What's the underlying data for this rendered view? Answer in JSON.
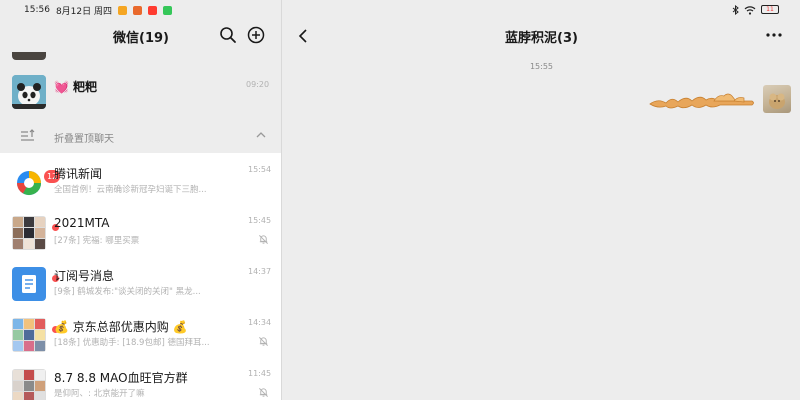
{
  "status_bar": {
    "time": "15:56",
    "date": "8月12日 周四",
    "battery": "11",
    "app_icon_colors": [
      "#f5a623",
      "#e9692c",
      "#ff3b30",
      "#35c759"
    ]
  },
  "left_header": {
    "title": "微信(19)",
    "icons": [
      "search-icon",
      "add-icon"
    ]
  },
  "pinned_chat": {
    "name": "粑粑",
    "time": "09:20",
    "emoji": "💓"
  },
  "fold_row": {
    "label": "折叠置顶聊天"
  },
  "chats": [
    {
      "name": "腾讯新闻",
      "preview": "全国首例！云南确诊新冠孕妇诞下三胞...",
      "time": "15:54",
      "badge": "12",
      "muted": false
    },
    {
      "name": "2021MTA",
      "preview": "[27条] 宪福: 哪里买票",
      "time": "15:45",
      "dot": true,
      "muted": true
    },
    {
      "name": "订阅号消息",
      "preview": "[9条] 鹤城发布:\"谈关闭的关闭\" 黑龙...",
      "time": "14:37",
      "dot": true,
      "muted": false
    },
    {
      "name": "京东总部优惠内购",
      "prefix_emoji": "💰",
      "suffix_emoji": "💰",
      "preview": "[18条] 优惠助手: [18.9包邮] 德国拜耳...",
      "time": "14:34",
      "dot": true,
      "muted": true
    },
    {
      "name": "8.7 8.8 MAO血旺官方群",
      "preview": "是仰阿、: 北京能开了嘛",
      "time": "11:45",
      "muted": true
    }
  ],
  "right_header": {
    "title": "蓝脖积泥(3)",
    "icons": [
      "back-icon",
      "more-icon"
    ]
  },
  "conversation": {
    "message_time": "15:55",
    "sticker_icon": "hands-reaching-sticker-icon"
  }
}
